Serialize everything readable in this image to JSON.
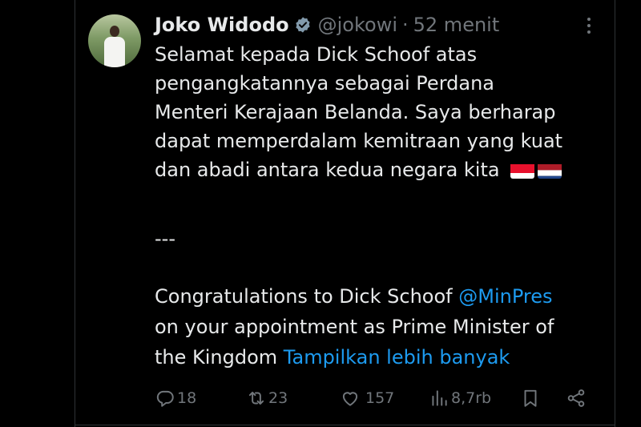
{
  "tweet": {
    "author_name": "Joko Widodo",
    "handle": "@jokowi",
    "separator": "·",
    "time": "52 menit",
    "lines_id": [
      "Selamat kepada Dick Schoof atas",
      "pengangkatannya sebagai Perdana",
      "Menteri Kerajaan Belanda. Saya berharap",
      "dapat memperdalam kemitraan yang kuat",
      "dan abadi antara kedua negara kita"
    ],
    "flags": [
      "Indonesia",
      "Netherlands"
    ],
    "separator_line": "---",
    "en_line1_prefix": "Congratulations to Dick Schoof ",
    "en_mention": "@MinPres",
    "en_line2": "on your appointment as Prime Minister of",
    "en_line3_prefix": "the Kingdom ",
    "show_more": "Tampilkan lebih banyak"
  },
  "actions": {
    "replies": "18",
    "reposts": "23",
    "likes": "157",
    "views": "8,7rb"
  },
  "icons": [
    "verified-badge-icon",
    "more-icon",
    "reply-icon",
    "repost-icon",
    "like-icon",
    "views-icon",
    "bookmark-icon",
    "share-icon"
  ],
  "colors": {
    "background": "#000000",
    "text": "#e7e9ea",
    "muted": "#71767b",
    "link": "#1d9bf0"
  }
}
